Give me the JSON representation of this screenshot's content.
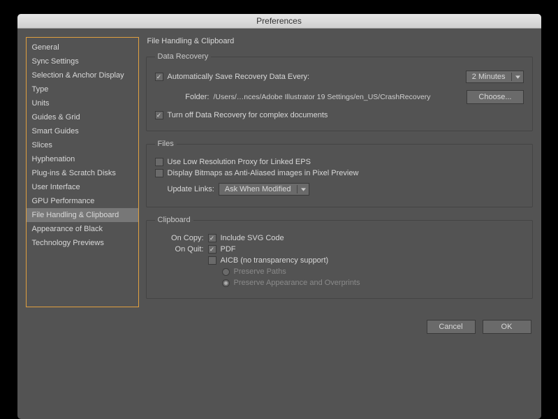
{
  "title": "Preferences",
  "sidebar": {
    "items": [
      {
        "label": "General"
      },
      {
        "label": "Sync Settings"
      },
      {
        "label": "Selection & Anchor Display"
      },
      {
        "label": "Type"
      },
      {
        "label": "Units"
      },
      {
        "label": "Guides & Grid"
      },
      {
        "label": "Smart Guides"
      },
      {
        "label": "Slices"
      },
      {
        "label": "Hyphenation"
      },
      {
        "label": "Plug-ins & Scratch Disks"
      },
      {
        "label": "User Interface"
      },
      {
        "label": "GPU Performance"
      },
      {
        "label": "File Handling & Clipboard"
      },
      {
        "label": "Appearance of Black"
      },
      {
        "label": "Technology Previews"
      }
    ],
    "active_index": 12
  },
  "page": {
    "heading": "File Handling & Clipboard"
  },
  "data_recovery": {
    "legend": "Data Recovery",
    "auto_save_label": "Automatically Save Recovery Data Every:",
    "interval": "2 Minutes",
    "folder_label": "Folder:",
    "folder_path": "/Users/…nces/Adobe Illustrator 19 Settings/en_US/CrashRecovery",
    "choose_label": "Choose...",
    "turn_off_label": "Turn off Data Recovery for complex documents"
  },
  "files": {
    "legend": "Files",
    "low_res_label": "Use Low Resolution Proxy for Linked EPS",
    "bitmaps_label": "Display Bitmaps as Anti-Aliased images in Pixel Preview",
    "update_links_label": "Update Links:",
    "update_links_value": "Ask When Modified"
  },
  "clipboard": {
    "legend": "Clipboard",
    "on_copy_label": "On Copy:",
    "include_svg_label": "Include SVG Code",
    "on_quit_label": "On Quit:",
    "pdf_label": "PDF",
    "aicb_label": "AICB (no transparency support)",
    "preserve_paths_label": "Preserve Paths",
    "preserve_appearance_label": "Preserve Appearance and Overprints"
  },
  "buttons": {
    "cancel": "Cancel",
    "ok": "OK"
  }
}
